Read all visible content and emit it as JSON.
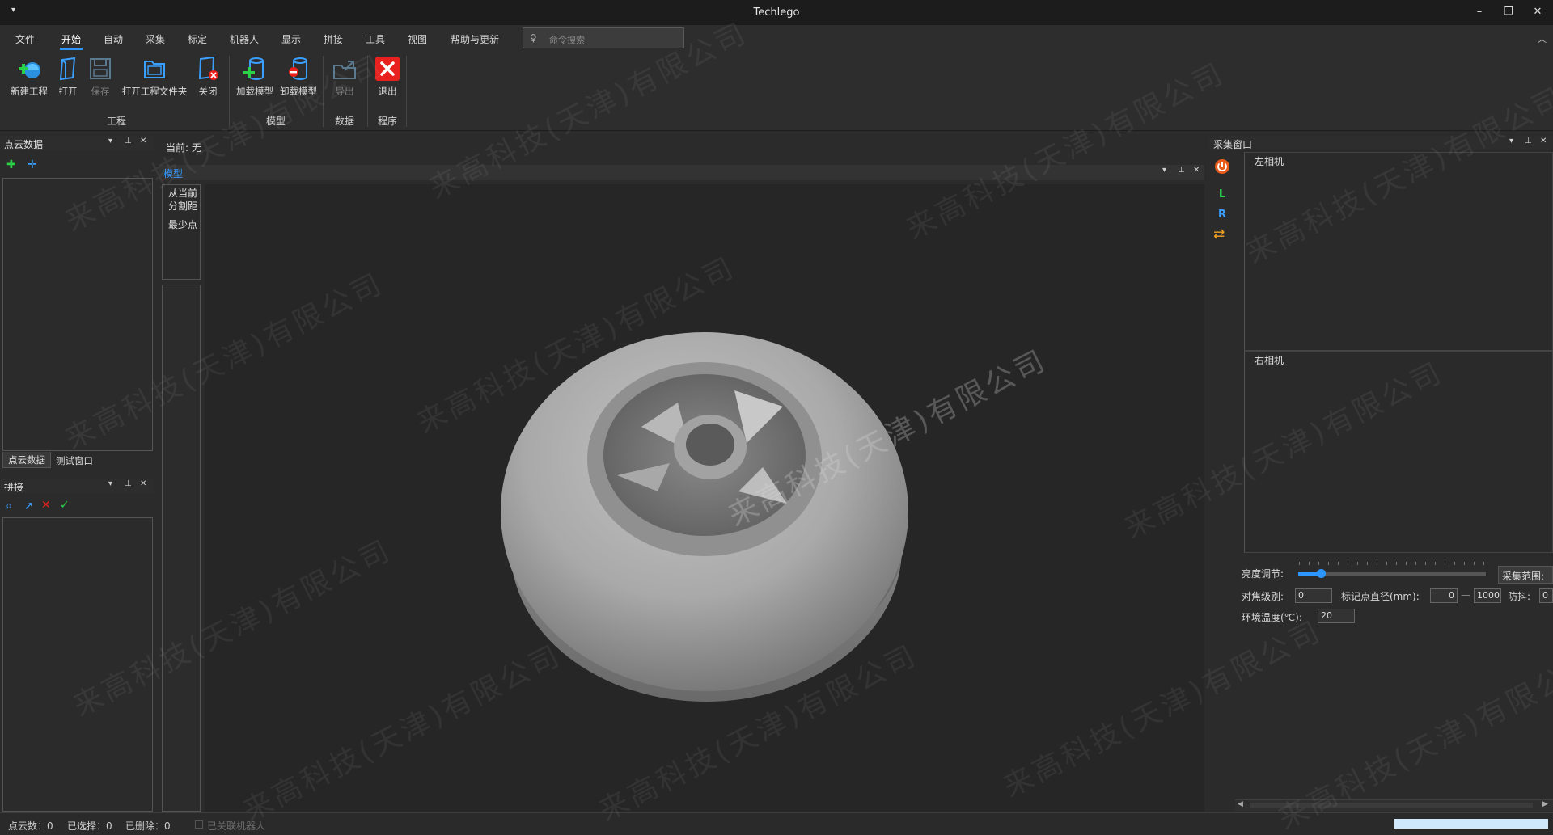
{
  "app": {
    "title": "Techlego",
    "qa_glyph": "▾"
  },
  "window_controls": {
    "minimize": "–",
    "restore": "❐",
    "close": "✕"
  },
  "menu": [
    "文件",
    "开始",
    "自动",
    "采集",
    "标定",
    "机器人",
    "显示",
    "拼接",
    "工具",
    "视图",
    "帮助与更新"
  ],
  "search": {
    "placeholder": "命令搜索",
    "icon": "lightbulb-icon"
  },
  "ribbon": {
    "buttons": [
      {
        "label": "新建工程",
        "icon": "new-project-icon",
        "enabled": true
      },
      {
        "label": "打开",
        "icon": "open-icon",
        "enabled": true
      },
      {
        "label": "保存",
        "icon": "save-icon",
        "enabled": false
      },
      {
        "label": "打开工程文件夹",
        "icon": "folder-icon",
        "enabled": true
      },
      {
        "label": "关闭",
        "icon": "close-project-icon",
        "enabled": true
      },
      {
        "label": "加载模型",
        "icon": "load-model-icon",
        "enabled": true
      },
      {
        "label": "卸载模型",
        "icon": "unload-model-icon",
        "enabled": true
      },
      {
        "label": "导出",
        "icon": "export-icon",
        "enabled": false
      },
      {
        "label": "退出",
        "icon": "exit-icon",
        "enabled": true
      }
    ],
    "groups": [
      "工程",
      "模型",
      "数据",
      "程序"
    ]
  },
  "left_panel": {
    "pointcloud_title": "点云数据",
    "tabs": [
      "点云数据",
      "测试窗口"
    ],
    "stitch_title": "拼接"
  },
  "center": {
    "current_label": "当前: 无",
    "model_tab": "模型",
    "side_lines": [
      "从当前",
      "分割距",
      "最少点"
    ]
  },
  "capture_panel": {
    "title": "采集窗口",
    "left_camera": "左相机",
    "right_camera": "右相机",
    "brightness_label": "亮度调节:",
    "brightness_value": 0.12,
    "range_button": "采集范围:",
    "focus_label": "对焦级别:",
    "focus_value": "0",
    "marker_label": "标记点直径(mm):",
    "marker_min": "0",
    "marker_dash": "—",
    "marker_max": "1000",
    "shake_label": "防抖:",
    "shake_value": "0",
    "temp_label": "环境温度(℃):",
    "temp_value": "20",
    "side_icons": [
      "power-icon",
      "left-camera-icon",
      "right-camera-icon",
      "swap-icon"
    ],
    "side_letters": [
      "L",
      "R"
    ]
  },
  "status": {
    "points": "点云数：0",
    "selected": "已选择：0",
    "deleted": "已删除：0",
    "robot": "已关联机器人"
  },
  "watermark": "来高科技(天津)有限公司",
  "colors": {
    "accent": "#2e97ff",
    "exit_red": "#e8201e",
    "progress": "#cfe8fb"
  }
}
